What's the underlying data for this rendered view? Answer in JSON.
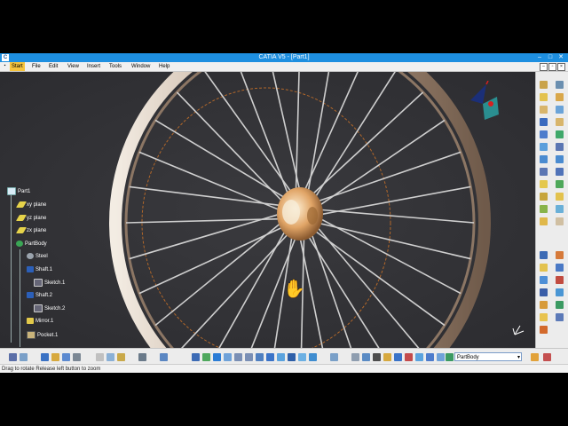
{
  "window": {
    "title": "CATIA V5 - [Part1]"
  },
  "menu": {
    "items": [
      {
        "label": "Start",
        "active": true
      },
      {
        "label": "File"
      },
      {
        "label": "Edit"
      },
      {
        "label": "View"
      },
      {
        "label": "Insert"
      },
      {
        "label": "Tools"
      },
      {
        "label": "Window"
      },
      {
        "label": "Help"
      }
    ]
  },
  "tree": {
    "root": "Part1",
    "nodes": [
      {
        "label": "xy plane",
        "icon": "plane-icon"
      },
      {
        "label": "yz plane",
        "icon": "plane-icon"
      },
      {
        "label": "zx plane",
        "icon": "plane-icon"
      },
      {
        "label": "PartBody",
        "icon": "partbody-icon"
      },
      {
        "label": "Steel",
        "icon": "material-icon"
      },
      {
        "label": "Shaft.1",
        "icon": "shaft-icon"
      },
      {
        "label": "Sketch.1",
        "icon": "sketch-icon"
      },
      {
        "label": "Shaft.2",
        "icon": "shaft-icon"
      },
      {
        "label": "Sketch.2",
        "icon": "sketch-icon"
      },
      {
        "label": "Mirror.1",
        "icon": "mirror-icon"
      },
      {
        "label": "Pocket.1",
        "icon": "pocket-icon"
      }
    ]
  },
  "toolbar": {
    "workbench_value": "PartBody"
  },
  "status": {
    "text": "Drag to rotate  Release left button to zoom"
  },
  "colors": {
    "titlebar": "#1e8fe0",
    "viewport": "#333338",
    "rim": "#c9b7a6",
    "spoke": "#cfcfcf",
    "hub": "#d99a5a",
    "dashed_circle": "#b3682a"
  }
}
